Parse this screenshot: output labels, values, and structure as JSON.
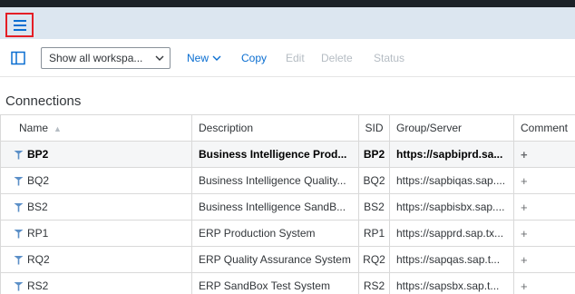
{
  "colors": {
    "shell_bg": "#dce6f0",
    "highlight_border": "#e41e26",
    "accent": "#0a6ed1",
    "disabled": "#b5bcc3",
    "icon_blue": "#5b8fc7"
  },
  "shell": {
    "menu_icon": "hamburger-menu-icon"
  },
  "toolbar": {
    "panel_icon": "side-panel-toggle-icon",
    "workspace_select": {
      "value": "Show all workspa...",
      "icon": "chevron-down-icon"
    },
    "new_label": "New",
    "new_icon": "chevron-down-icon",
    "copy_label": "Copy",
    "edit_label": "Edit",
    "delete_label": "Delete",
    "status_label": "Status"
  },
  "section": {
    "title": "Connections"
  },
  "table": {
    "headers": {
      "name": "Name",
      "name_sort": "▲",
      "description": "Description",
      "sid": "SID",
      "group_server": "Group/Server",
      "comment": "Comment"
    },
    "rows": [
      {
        "name": "BP2",
        "description": "Business Intelligence Prod...",
        "sid": "BP2",
        "server": "https://sapbiprd.sa...",
        "comment": "+"
      },
      {
        "name": "BQ2",
        "description": "Business Intelligence Quality...",
        "sid": "BQ2",
        "server": "https://sapbiqas.sap....",
        "comment": "+"
      },
      {
        "name": "BS2",
        "description": "Business Intelligence SandB...",
        "sid": "BS2",
        "server": "https://sapbisbx.sap....",
        "comment": "+"
      },
      {
        "name": "RP1",
        "description": "ERP Production System",
        "sid": "RP1",
        "server": "https://sapprd.sap.tx...",
        "comment": "+"
      },
      {
        "name": "RQ2",
        "description": "ERP Quality Assurance System",
        "sid": "RQ2",
        "server": "https://sapqas.sap.t...",
        "comment": "+"
      },
      {
        "name": "RS2",
        "description": "ERP SandBox Test System",
        "sid": "RS2",
        "server": "https://sapsbx.sap.t...",
        "comment": "+"
      }
    ]
  }
}
